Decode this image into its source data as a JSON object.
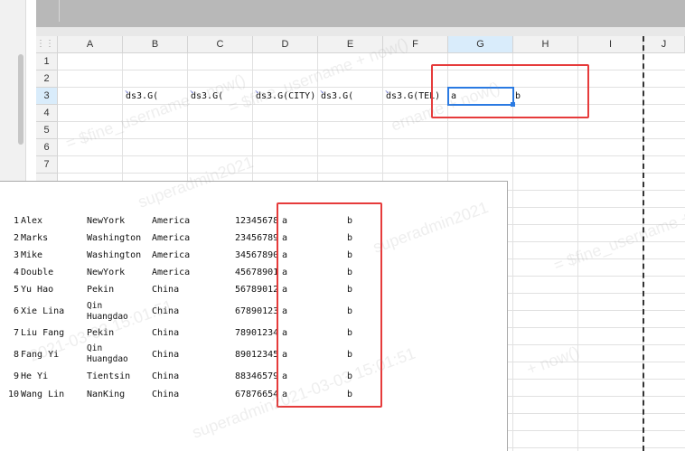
{
  "sheet": {
    "columns": [
      "A",
      "B",
      "C",
      "D",
      "E",
      "F",
      "G",
      "H",
      "I",
      "J"
    ],
    "selected_column": "G",
    "rows": [
      "1",
      "2",
      "3",
      "4",
      "5",
      "6",
      "7"
    ],
    "selected_row": "3",
    "row3": {
      "b": "ds3.G(",
      "c": "ds3.G(",
      "d": "ds3.G(CITY)",
      "e": "ds3.G(",
      "f": "ds3.G(TEL)",
      "g": "a",
      "h": "b"
    }
  },
  "preview": {
    "rows": [
      {
        "no": "1",
        "name": "Alex",
        "city": "NewYork",
        "country": "America",
        "tel": "12345678",
        "a": "a",
        "b": "b"
      },
      {
        "no": "2",
        "name": "Marks",
        "city": "Washington",
        "country": "America",
        "tel": "23456789",
        "a": "a",
        "b": "b"
      },
      {
        "no": "3",
        "name": "Mike",
        "city": "Washington",
        "country": "America",
        "tel": "34567890",
        "a": "a",
        "b": "b"
      },
      {
        "no": "4",
        "name": "Double",
        "city": "NewYork",
        "country": "America",
        "tel": "45678901",
        "a": "a",
        "b": "b"
      },
      {
        "no": "5",
        "name": "Yu Hao",
        "city": "Pekin",
        "country": "China",
        "tel": "56789012",
        "a": "a",
        "b": "b"
      },
      {
        "no": "6",
        "name": "Xie Lina",
        "city": "Qin Huangdao",
        "city1": "Qin",
        "city2": "Huangdao",
        "country": "China",
        "tel": "67890123",
        "a": "a",
        "b": "b"
      },
      {
        "no": "7",
        "name": "Liu Fang",
        "city": "Pekin",
        "country": "China",
        "tel": "78901234",
        "a": "a",
        "b": "b"
      },
      {
        "no": "8",
        "name": "Fang Yi",
        "city": "Qin Huangdao",
        "city1": "Qin",
        "city2": "Huangdao",
        "country": "China",
        "tel": "89012345",
        "a": "a",
        "b": "b"
      },
      {
        "no": "9",
        "name": "He Yi",
        "city": "Tientsin",
        "country": "China",
        "tel": "88346579",
        "a": "a",
        "b": "b"
      },
      {
        "no": "10",
        "name": "Wang Lin",
        "city": "NanKing",
        "country": "China",
        "tel": "67876654",
        "a": "a",
        "b": "b"
      }
    ]
  },
  "watermark": {
    "user": "superadmin2021",
    "datetime": "superadmin2021-03-03 15:01:51",
    "time": "2021-03-03 15:01:51",
    "fine1": "= $fine_username + now()",
    "fine2": "+ now()",
    "fine3": "ername + now()"
  },
  "colors": {
    "highlight": "#e63b3b",
    "active": "#2a7ae2",
    "header_selected": "#d9ecfb"
  }
}
